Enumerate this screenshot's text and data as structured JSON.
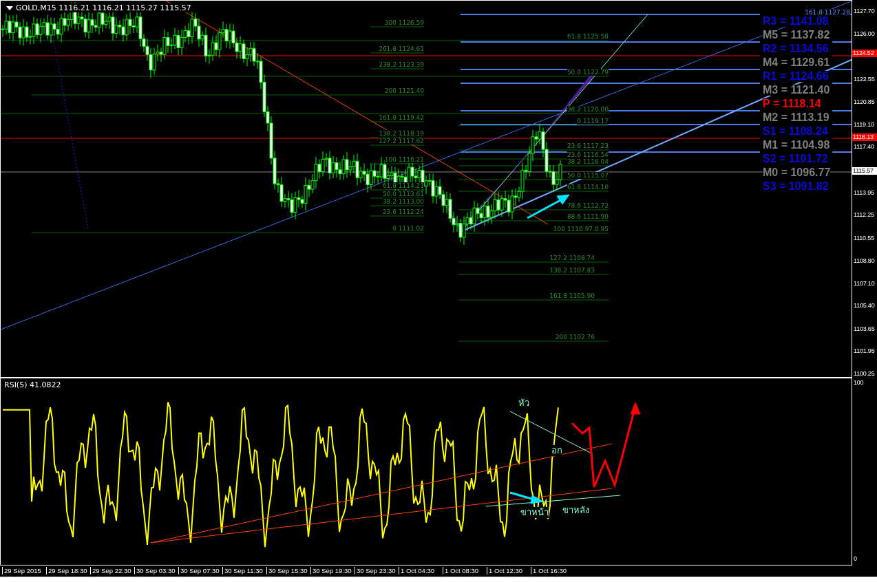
{
  "chart": {
    "title": "GOLD,M15 1116.21 1116.21 1115.27 1115.57",
    "price_axis": {
      "ticks": [
        "1127.70",
        "1126.00",
        "1122.55",
        "1120.85",
        "1119.10",
        "1117.40",
        "1113.95",
        "1112.25",
        "1110.55",
        "1108.80",
        "1107.10",
        "1105.40",
        "1103.65",
        "1101.95",
        "1100.25"
      ],
      "tags": [
        {
          "text": "1124.52",
          "kind": "line"
        },
        {
          "text": "1118.13",
          "kind": "line"
        },
        {
          "text": "1115.57",
          "kind": "bid"
        }
      ]
    },
    "fib_labels_left": [
      "300 1126.59",
      "261.8 1124.61",
      "238.2 1123.39",
      "200 1121.40",
      "161.8 1119.42",
      "138.2 1118.19",
      "127.2 1117.62",
      "100 1116.21",
      "61.8 1114.21",
      "50.0 1113.61",
      "38.2 1113.00",
      "23.6 1112.24",
      "0 1111.02"
    ],
    "fib_labels_right": [
      "61.8 1125.58",
      "50.0 1122.79",
      "38.2 1120.00",
      "0 1119.17",
      "23.6 1117.23",
      "23.6 1116.54",
      "38.2 1116.04",
      "50.0 1115.07",
      "61.8 1114.10",
      "78.6 1112.72",
      "88.6 1111.90",
      "100 1110.97.0.95",
      "127.2 1108.74",
      "138.2 1107.83",
      "161.8 1105.90",
      "200 1102.76"
    ],
    "fib_labels_far_right": [
      "161.8 1127.28"
    ],
    "pivot_levels": [
      {
        "text": "R3 = 1141.08",
        "color": "#0a0adc"
      },
      {
        "text": "M5 = 1137.82",
        "color": "#7f7f7f"
      },
      {
        "text": "R2 = 1134.56",
        "color": "#0a0adc"
      },
      {
        "text": "M4 = 1129.61",
        "color": "#7f7f7f"
      },
      {
        "text": "R1 = 1124.66",
        "color": "#0a0adc"
      },
      {
        "text": "M3 = 1121.40",
        "color": "#7f7f7f"
      },
      {
        "text": "P  = 1118.14",
        "color": "#ff0000"
      },
      {
        "text": "M2 = 1113.19",
        "color": "#7f7f7f"
      },
      {
        "text": "S1 = 1108.24",
        "color": "#0a0adc"
      },
      {
        "text": "M1 = 1104.98",
        "color": "#7f7f7f"
      },
      {
        "text": "S2 = 1101.72",
        "color": "#0a0adc"
      },
      {
        "text": "M0 = 1096.77",
        "color": "#7f7f7f"
      },
      {
        "text": "S3 = 1091.82",
        "color": "#0a0adc"
      }
    ]
  },
  "rsi": {
    "title": "RSI(5) 41.0822",
    "axis": [
      "100",
      "0"
    ],
    "annotations": [
      "หัว",
      "อก",
      "ขาหน้า",
      "ขาหลัง"
    ]
  },
  "time_axis": [
    "29 Sep 2015",
    "29 Sep 18:30",
    "29 Sep 22:30",
    "30 Sep 03:30",
    "30 Sep 07:30",
    "30 Sep 11:30",
    "30 Sep 15:30",
    "30 Sep 19:30",
    "30 Sep 23:30",
    "1 Oct 04:30",
    "1 Oct 08:30",
    "1 Oct 12:30",
    "1 Oct 16:30"
  ]
}
